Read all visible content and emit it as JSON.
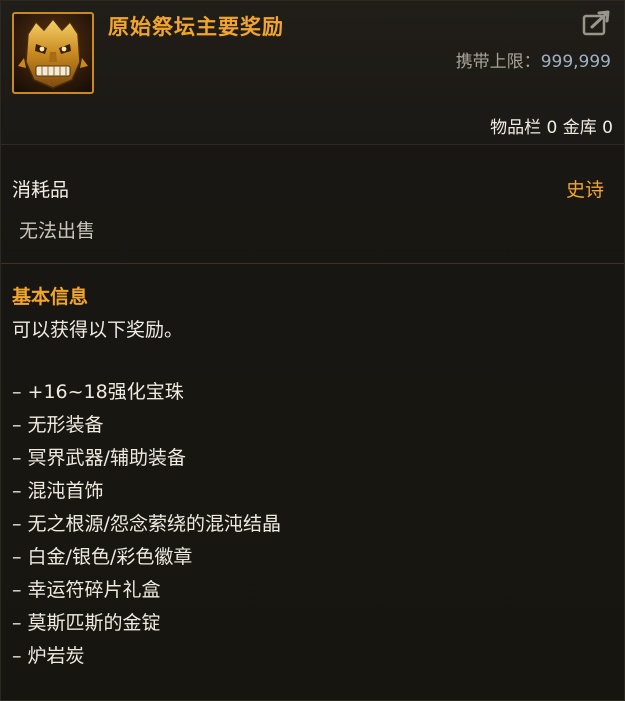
{
  "item": {
    "name": "原始祭坛主要奖励",
    "icon": "golden-lion-mask-icon",
    "carry_label": "携带上限：",
    "carry_value": "999,999",
    "storage": "物品栏 0 金库 0"
  },
  "details": {
    "category": "消耗品",
    "rarity": "史诗",
    "sell_status": "无法出售"
  },
  "basic_info": {
    "title": "基本信息",
    "description": "可以获得以下奖励。",
    "rewards": [
      "– +16~18强化宝珠",
      "– 无形装备",
      "– 冥界武器/辅助装备",
      "– 混沌首饰",
      "– 无之根源/怨念萦绕的混沌结晶",
      "– 白金/银色/彩色徽章",
      "– 幸运符碎片礼盒",
      "– 莫斯匹斯的金锭",
      "– 炉岩炭"
    ]
  },
  "colors": {
    "title": "#f2a52b",
    "rarity_epic": "#f2a52b",
    "background": "#191713"
  }
}
